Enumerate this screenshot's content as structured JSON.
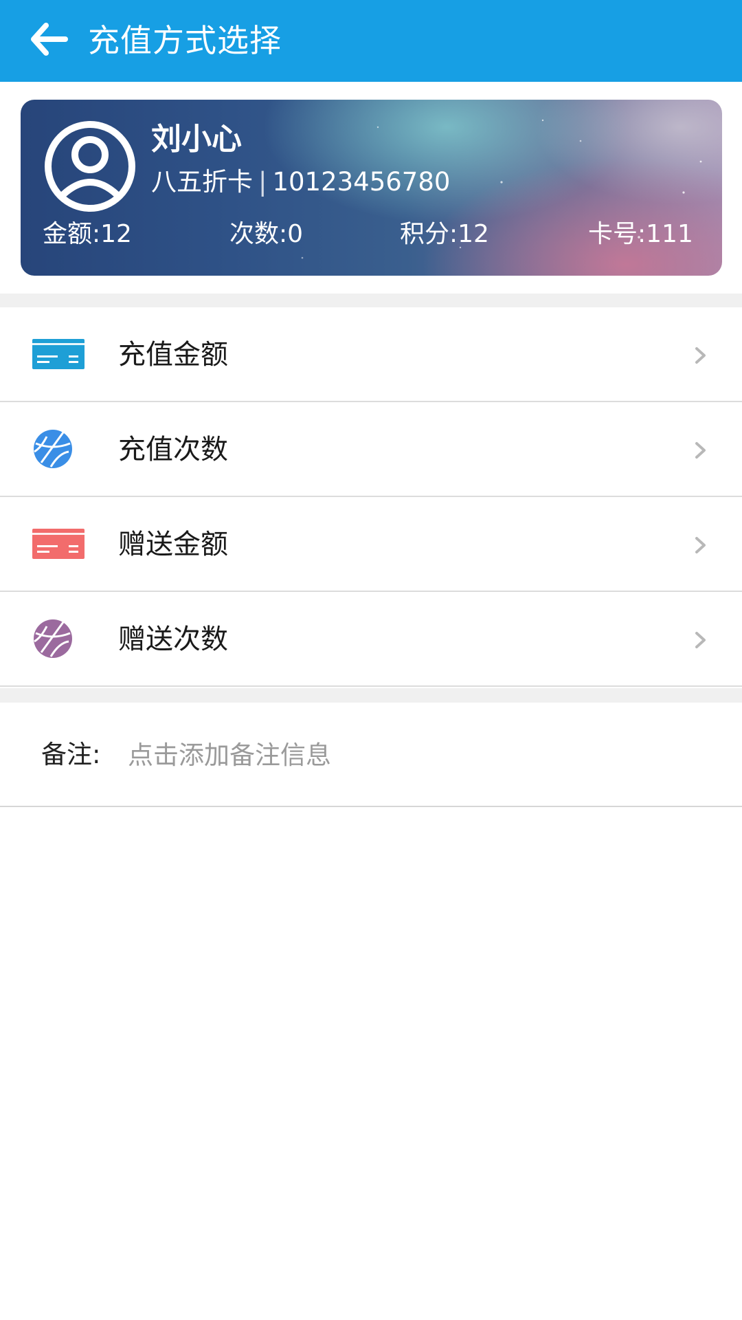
{
  "header": {
    "title": "充值方式选择",
    "background": "#179fe4"
  },
  "member_card": {
    "name": "刘小心",
    "card_type": "八五折卡",
    "separator": "|",
    "phone": "10123456780",
    "stats": {
      "amount": "金额:12",
      "times": "次数:0",
      "points": "积分:12",
      "card_no": "卡号:111"
    }
  },
  "menu": {
    "items": [
      {
        "label": "充值金额",
        "icon": "card-icon",
        "color": "#1e9fd6"
      },
      {
        "label": "充值次数",
        "icon": "basketball-icon",
        "color": "#3a8ee6"
      },
      {
        "label": "赠送金额",
        "icon": "card-icon",
        "color": "#f26c6c"
      },
      {
        "label": "赠送次数",
        "icon": "basketball-icon",
        "color": "#9b6a9e"
      }
    ]
  },
  "note": {
    "label": "备注:",
    "placeholder": "点击添加备注信息"
  }
}
